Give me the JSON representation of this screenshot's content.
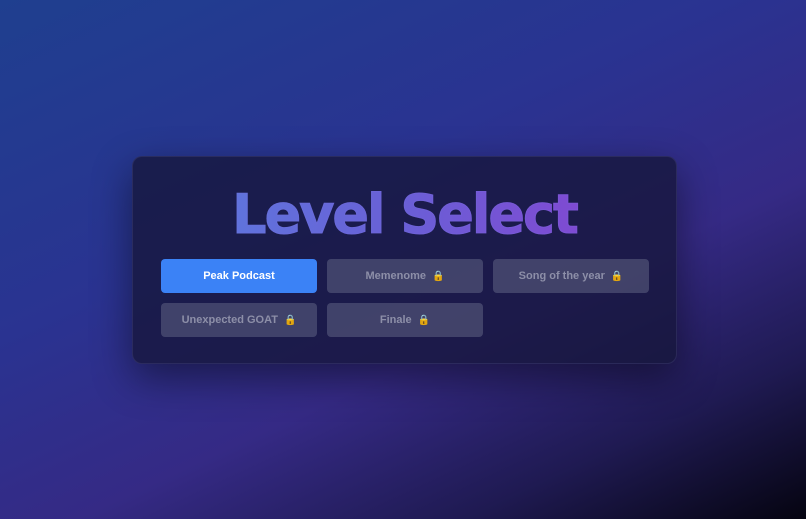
{
  "title": "Level Select",
  "levels": [
    {
      "label": "Peak Podcast",
      "locked": false,
      "active": true
    },
    {
      "label": "Memenome",
      "locked": true,
      "active": false
    },
    {
      "label": "Song of the year",
      "locked": true,
      "active": false
    },
    {
      "label": "Unexpected GOAT",
      "locked": true,
      "active": false
    },
    {
      "label": "Finale",
      "locked": true,
      "active": false
    }
  ],
  "icons": {
    "lock": "lock-icon"
  },
  "colors": {
    "active_button": "#3b82f6",
    "locked_button": "#6e7391",
    "title_gradient_start": "#5a7fe0",
    "title_gradient_end": "#8a3fd0"
  }
}
